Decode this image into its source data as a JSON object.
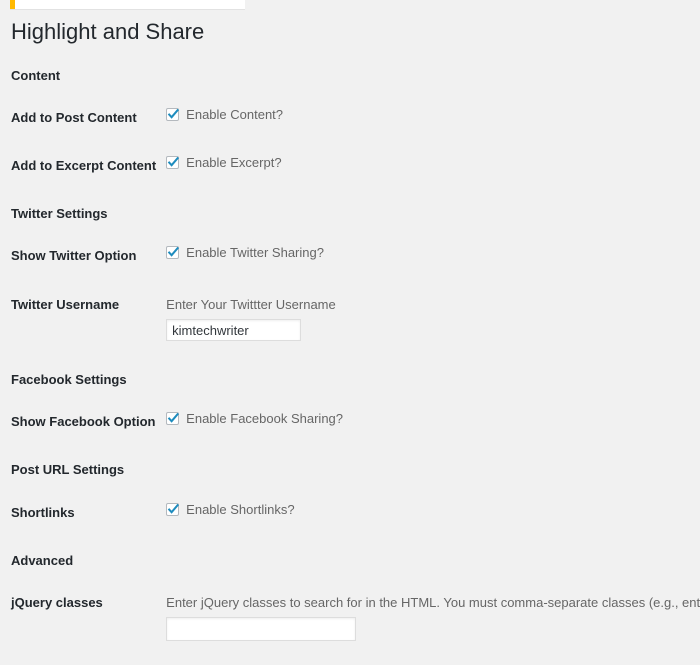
{
  "notice": {
    "accent_color": "#ffb900",
    "background_color": "#ffffff"
  },
  "page": {
    "title": "Highlight and Share"
  },
  "sections": [
    {
      "heading": "Content",
      "fields": [
        {
          "label": "Add to Post Content",
          "type": "checkbox",
          "checkbox_label": "Enable Content?",
          "checked": true
        },
        {
          "label": "Add to Excerpt Content",
          "type": "checkbox",
          "checkbox_label": "Enable Excerpt?",
          "checked": true
        }
      ]
    },
    {
      "heading": "Twitter Settings",
      "fields": [
        {
          "label": "Show Twitter Option",
          "type": "checkbox",
          "checkbox_label": "Enable Twitter Sharing?",
          "checked": true
        },
        {
          "label": "Twitter Username",
          "type": "text",
          "description": "Enter Your Twittter Username",
          "value": "kimtechwriter",
          "placeholder": ""
        }
      ]
    },
    {
      "heading": "Facebook Settings",
      "fields": [
        {
          "label": "Show Facebook Option",
          "type": "checkbox",
          "checkbox_label": "Enable Facebook Sharing?",
          "checked": true
        }
      ]
    },
    {
      "heading": "Post URL Settings",
      "fields": [
        {
          "label": "Shortlinks",
          "type": "checkbox",
          "checkbox_label": "Enable Shortlinks?",
          "checked": true
        }
      ]
    },
    {
      "heading": "Advanced",
      "fields": [
        {
          "label": "jQuery classes",
          "type": "text",
          "description": "Enter jQuery classes to search for in the HTML. You must comma-separate classes (e.g., entry-content,post,page).",
          "value": "",
          "placeholder": ""
        }
      ]
    }
  ],
  "colors": {
    "page_background": "#f1f1f1",
    "heading_text": "#23282d",
    "secondary_text": "#666666",
    "checkbox_check": "#1e8cbe",
    "input_border": "#dddddd"
  }
}
